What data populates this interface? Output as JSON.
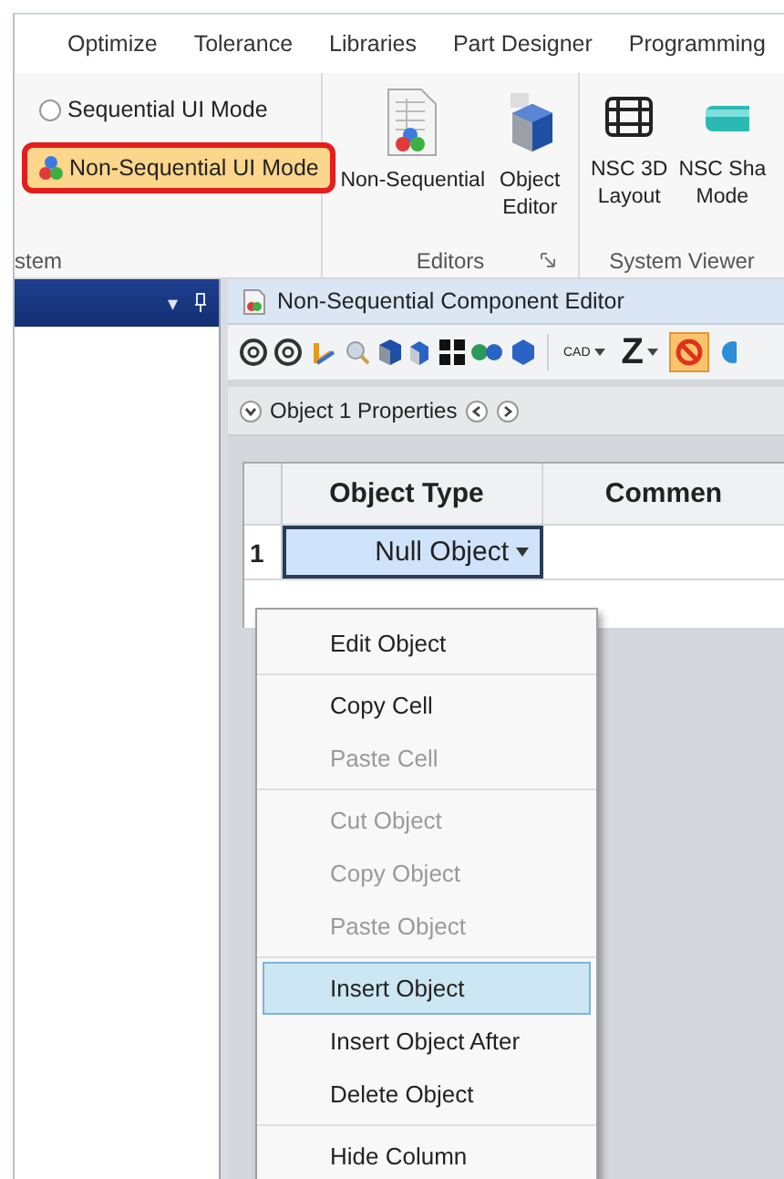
{
  "ribbon_tabs": [
    {
      "label": "Optimize"
    },
    {
      "label": "Tolerance"
    },
    {
      "label": "Libraries"
    },
    {
      "label": "Part Designer"
    },
    {
      "label": "Programming"
    }
  ],
  "ribbon_groups": [
    {
      "kind": "modes",
      "label": "stem",
      "options": [
        {
          "label": "Sequential UI Mode",
          "selected": false
        },
        {
          "label": "Non-Sequential UI Mode",
          "selected": true
        }
      ]
    },
    {
      "kind": "buttons",
      "label": "Editors",
      "launcher": true,
      "buttons": [
        {
          "kind": "sheet",
          "label": "Non-Sequential"
        },
        {
          "kind": "cube",
          "label": "Object\nEditor"
        }
      ]
    },
    {
      "kind": "buttons",
      "label": "System Viewer",
      "buttons": [
        {
          "kind": "frame",
          "label": "NSC 3D\nLayout"
        },
        {
          "kind": "cylinder",
          "label": "NSC Sha\nMode"
        }
      ]
    }
  ],
  "side_panel": {
    "menu_glyph": "▾"
  },
  "editor": {
    "title": "Non-Sequential Component Editor",
    "toolbar": {
      "dropdowns": [
        {
          "label": "CAD",
          "small": true
        },
        {
          "label": "Z",
          "small": false
        }
      ],
      "stop_pressed": true
    },
    "properties_bar": {
      "label": "Object 1 Properties",
      "expanded": true
    },
    "table": {
      "columns": [
        "Object Type",
        "Commen"
      ],
      "rows": [
        {
          "number": "1",
          "object_type": "Null Object",
          "selected": true
        }
      ]
    }
  },
  "context_menu": {
    "sections": [
      {
        "items": [
          {
            "label": "Edit Object",
            "disabled": false,
            "selected": false
          }
        ]
      },
      {
        "items": [
          {
            "label": "Copy Cell",
            "disabled": false,
            "selected": false
          },
          {
            "label": "Paste Cell",
            "disabled": true,
            "selected": false
          }
        ]
      },
      {
        "items": [
          {
            "label": "Cut Object",
            "disabled": true,
            "selected": false
          },
          {
            "label": "Copy Object",
            "disabled": true,
            "selected": false
          },
          {
            "label": "Paste Object",
            "disabled": true,
            "selected": false
          }
        ]
      },
      {
        "items": [
          {
            "label": "Insert Object",
            "disabled": false,
            "selected": true
          },
          {
            "label": "Insert Object After",
            "disabled": false,
            "selected": false
          },
          {
            "label": "Delete Object",
            "disabled": false,
            "selected": false
          }
        ]
      },
      {
        "items": [
          {
            "label": "Hide Column",
            "disabled": false,
            "selected": false
          }
        ]
      }
    ]
  }
}
